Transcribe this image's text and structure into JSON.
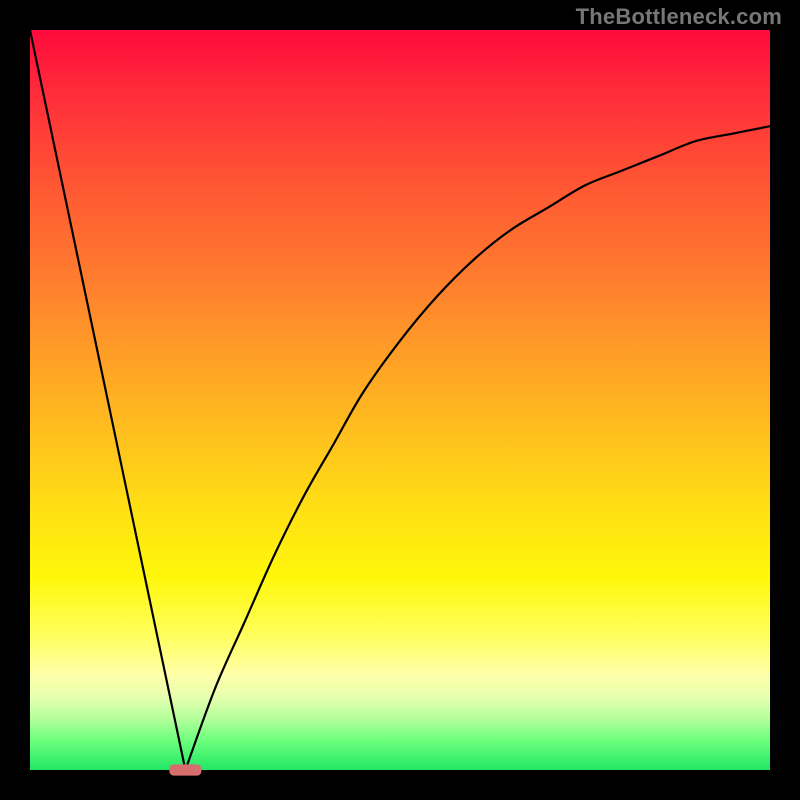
{
  "watermark": "TheBottleneck.com",
  "chart_data": {
    "type": "line",
    "title": "",
    "xlabel": "",
    "ylabel": "",
    "xlim": [
      0,
      1
    ],
    "ylim": [
      0,
      1
    ],
    "grid": false,
    "legend": false,
    "series": [
      {
        "name": "left-linear-branch",
        "x": [
          0.0,
          0.21
        ],
        "y": [
          1.0,
          0.0
        ]
      },
      {
        "name": "right-curve-branch",
        "x": [
          0.21,
          0.25,
          0.29,
          0.33,
          0.37,
          0.41,
          0.45,
          0.5,
          0.55,
          0.6,
          0.65,
          0.7,
          0.75,
          0.8,
          0.85,
          0.9,
          0.95,
          1.0
        ],
        "y": [
          0.0,
          0.11,
          0.2,
          0.29,
          0.37,
          0.44,
          0.51,
          0.58,
          0.64,
          0.69,
          0.73,
          0.76,
          0.79,
          0.81,
          0.83,
          0.85,
          0.86,
          0.87
        ]
      }
    ],
    "marker": {
      "name": "bottleneck-marker",
      "x": 0.21,
      "y": 0.0,
      "width_frac": 0.042,
      "height_frac": 0.014
    },
    "gradient_stops": [
      {
        "pos": 0.0,
        "color": "#ff0a3d"
      },
      {
        "pos": 0.5,
        "color": "#ffc41d"
      },
      {
        "pos": 0.8,
        "color": "#ffff60"
      },
      {
        "pos": 1.0,
        "color": "#22e765"
      }
    ]
  }
}
